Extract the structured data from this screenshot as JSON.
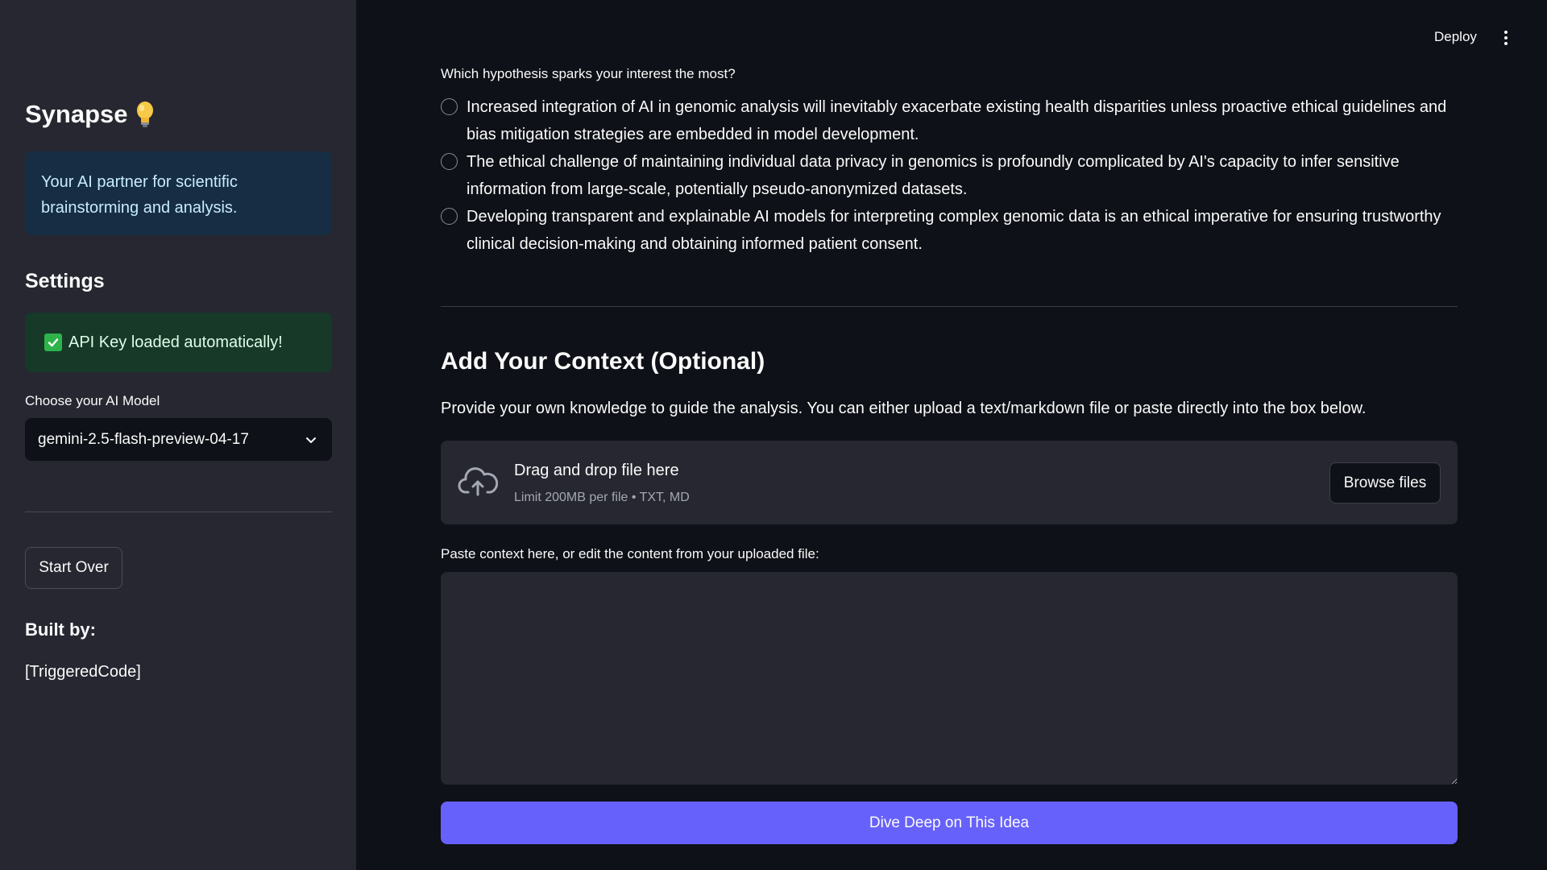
{
  "sidebar": {
    "brand_title": "Synapse",
    "brand_icon": "lightbulb-icon",
    "info_text": "Your AI partner for scientific brainstorming and analysis.",
    "settings_heading": "Settings",
    "api_status": "API Key loaded automatically!",
    "model_label": "Choose your AI Model",
    "model_selected": "gemini-2.5-flash-preview-04-17",
    "start_over_label": "Start Over",
    "built_by_heading": "Built by:",
    "built_by_value": "[TriggeredCode]"
  },
  "header": {
    "deploy_label": "Deploy"
  },
  "hypotheses": {
    "question": "Which hypothesis sparks your interest the most?",
    "options": [
      "Increased integration of AI in genomic analysis will inevitably exacerbate existing health disparities unless proactive ethical guidelines and bias mitigation strategies are embedded in model development.",
      "The ethical challenge of maintaining individual data privacy in genomics is profoundly complicated by AI's capacity to infer sensitive information from large-scale, potentially pseudo-anonymized datasets.",
      "Developing transparent and explainable AI models for interpreting complex genomic data is an ethical imperative for ensuring trustworthy clinical decision-making and obtaining informed patient consent."
    ]
  },
  "context": {
    "heading": "Add Your Context (Optional)",
    "description": "Provide your own knowledge to guide the analysis. You can either upload a text/markdown file or paste directly into the box below.",
    "dropzone_title": "Drag and drop file here",
    "dropzone_limit": "Limit 200MB per file • TXT, MD",
    "browse_label": "Browse files",
    "textarea_label": "Paste context here, or edit the content from your uploaded file:",
    "textarea_value": ""
  },
  "actions": {
    "dive_deep_label": "Dive Deep on This Idea"
  },
  "colors": {
    "primary": "#6761fb",
    "sidebar_bg": "#262730",
    "main_bg": "#0e1117",
    "info_bg": "#172d43",
    "success_bg": "#173928"
  }
}
